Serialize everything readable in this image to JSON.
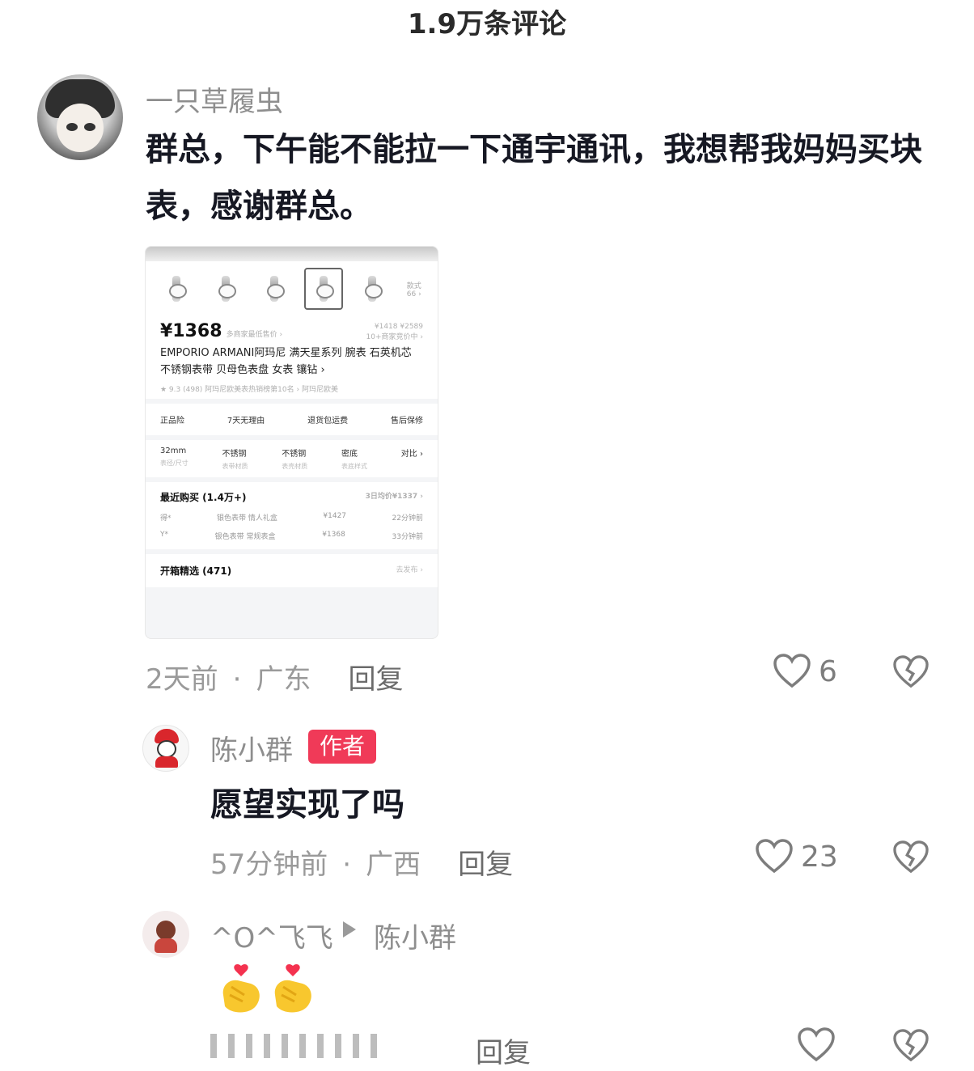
{
  "header": {
    "title": "1.9万条评论"
  },
  "comments": [
    {
      "username": "一只草履虫",
      "text": "群总，下午能不能拉一下通宇通讯，我想帮我妈妈买块表，感谢群总。",
      "time": "2天前",
      "location": "广东",
      "reply_label": "回复",
      "likes": "6",
      "screenshot": {
        "price": "¥1368",
        "price_note": "多商家最低售价 ›",
        "price_compare": "¥1418  ¥2589",
        "offers": "10+商家竞价中 ›",
        "title": "EMPORIO ARMANI阿玛尼 满天星系列 腕表 石英机芯 不锈钢表带 贝母色表盘 女表 镶钻 ›",
        "rating": "★ 9.3 (498)   阿玛尼欧美表热销榜第10名 ›   阿玛尼欧美",
        "thumb_more": "款式 66 ›",
        "services": [
          "正品险",
          "7天无理由",
          "退货包运费",
          "售后保修"
        ],
        "specs": [
          {
            "value": "32mm",
            "label": "表径/尺寸"
          },
          {
            "value": "不锈钢",
            "label": "表带材质"
          },
          {
            "value": "不锈钢",
            "label": "表壳材质"
          },
          {
            "value": "密底",
            "label": "表底样式"
          },
          {
            "value": "对比 ›",
            "label": ""
          }
        ],
        "recent_title": "最近购买 (1.4万+)",
        "recent_avg": "3日均价¥1337 ›",
        "recent_rows": [
          {
            "user": "得*",
            "item": "银色表带 情人礼盒",
            "price": "¥1427",
            "time": "22分钟前"
          },
          {
            "user": "Y*",
            "item": "银色表带 常规表盒",
            "price": "¥1368",
            "time": "33分钟前"
          }
        ],
        "open_box": "开箱精选 (471)",
        "open_box_action": "去发布 ›"
      }
    },
    {
      "username": "陈小群",
      "badge": "作者",
      "text": "愿望实现了吗",
      "time": "57分钟前",
      "location": "广西",
      "reply_label": "回复",
      "likes": "23"
    },
    {
      "username": "^O^飞飞",
      "reply_to": "陈小群",
      "text": "🫰🫰",
      "reply_label": "回复"
    }
  ],
  "icons": {
    "like": "heart-outline-icon",
    "dislike": "broken-heart-icon",
    "reply_arrow": "triangle-right-icon"
  },
  "colors": {
    "author_badge": "#f03a58",
    "meta_text": "#9a9a9a"
  }
}
